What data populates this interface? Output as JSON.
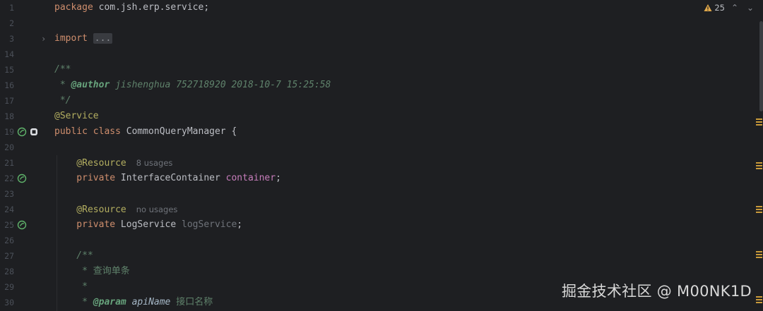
{
  "editor": {
    "warnings_count": "25",
    "line_numbers": [
      "1",
      "2",
      "3",
      "14",
      "15",
      "16",
      "17",
      "18",
      "19",
      "20",
      "21",
      "22",
      "23",
      "24",
      "25",
      "26",
      "27",
      "28",
      "29",
      "30"
    ],
    "lines": {
      "l1_kw": "package",
      "l1_rest": " com.jsh.erp.service;",
      "l3_kw": "import",
      "l3_fold": "...",
      "l15": "/**",
      "l16_star": " * ",
      "l16_tag": "@author",
      "l16_val": " jishenghua 752718920 2018-10-7 15:25:58",
      "l17": " */",
      "l18": "@Service",
      "l19_kw": "public class",
      "l19_rest": " CommonQueryManager {",
      "l21_ann": "    @Resource",
      "l21_hint": "8 usages",
      "l22_kw": "    private",
      "l22_type": " InterfaceContainer ",
      "l22_field": "container",
      "l22_end": ";",
      "l24_ann": "    @Resource",
      "l24_hint": "no usages",
      "l25_kw": "    private",
      "l25_type": " LogService ",
      "l25_field": "logService",
      "l25_end": ";",
      "l27": "    /**",
      "l28_star": "     * ",
      "l28_text": "查询单条",
      "l29": "     *",
      "l30_star": "     * ",
      "l30_tag": "@param",
      "l30_val": " apiName ",
      "l30_text": "接口名称"
    }
  },
  "icons": {
    "bean": "spring-bean-icon",
    "run": "run-config-icon",
    "warning": "warning-icon"
  },
  "watermark": "掘金技术社区 @ M00NK1D"
}
